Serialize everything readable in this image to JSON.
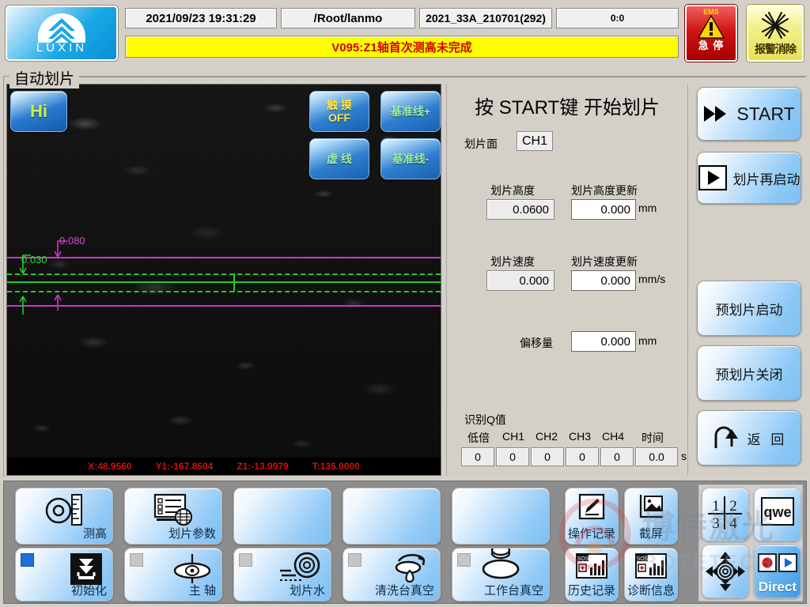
{
  "header": {
    "logo_text": "LUXIN",
    "logo_icon": "luxin-chevron-logo",
    "datetime": "2021/09/23 19:31:29",
    "path": "/Root/lanmo",
    "recipe": "2021_33A_210701(292)",
    "counter": "0:0",
    "alarm_message": "V095:Z1轴首次测高未完成",
    "emergency_stop": {
      "top": "EMS",
      "label": "急 停",
      "icon": "warning-triangle-icon"
    },
    "alarm_clear": {
      "label": "报警消除",
      "icon": "burst-star-icon"
    },
    "colors": {
      "alarm_bg": "#ffff00",
      "alarm_text": "#d00000",
      "ems_red": "#cf1414",
      "alarm_clear_yellow": "#e8e257",
      "logo_blue": "#19a8e8"
    }
  },
  "page": {
    "title": "自动划片"
  },
  "video": {
    "hi_button": "Hi",
    "overlay_buttons": [
      {
        "name": "touch-toggle",
        "line1": "触 摸",
        "line2": "OFF",
        "color": "yellow"
      },
      {
        "name": "baseline-plus",
        "line1": "基准线+",
        "line2": "",
        "color": "green"
      },
      {
        "name": "dashed-line",
        "line1": "虚 线",
        "line2": "",
        "color": "green"
      },
      {
        "name": "baseline-minus",
        "line1": "基准线-",
        "line2": "",
        "color": "green"
      }
    ],
    "annotations": [
      {
        "value": "0.080",
        "color": "#dd44dd"
      },
      {
        "value": "0.030",
        "color": "#33dd33"
      }
    ],
    "coordinates": [
      {
        "label": "X:",
        "value": "48.9560",
        "full": "X:48.9560"
      },
      {
        "label": "Y1:",
        "value": "-167.8504",
        "full": "Y1:-167.8504"
      },
      {
        "label": "Z1:",
        "value": "-13.9979",
        "full": "Z1:-13.9979"
      },
      {
        "label": "T:",
        "value": "135.0000",
        "full": "T:135.0000"
      }
    ],
    "colors": {
      "magenta_line": "#cc33cc",
      "green_line": "#22cc22",
      "coord_text": "#cc1111"
    }
  },
  "center": {
    "instruction": "按 START键 开始划片",
    "cut_face_label": "划片面",
    "cut_face_value": "CH1",
    "cut_height_label": "划片高度",
    "cut_height_value": "0.0600",
    "cut_height_update_label": "划片高度更新",
    "cut_height_update_value": "0.000",
    "cut_height_unit": "mm",
    "cut_speed_label": "划片速度",
    "cut_speed_value": "0.000",
    "cut_speed_update_label": "划片速度更新",
    "cut_speed_update_value": "0.000",
    "cut_speed_unit": "mm/s",
    "offset_label": "偏移量",
    "offset_value": "0.000",
    "offset_unit": "mm",
    "q_title": "识别Q值",
    "q_headers": [
      "低倍",
      "CH1",
      "CH2",
      "CH3",
      "CH4",
      "时间"
    ],
    "q_values": [
      "0",
      "0",
      "0",
      "0",
      "0",
      "0.0"
    ],
    "q_unit": "s"
  },
  "sidebar": {
    "buttons": [
      {
        "label": "START",
        "icon": "double-arrow-play-icon"
      },
      {
        "label": "划片再启动",
        "icon": "play-button-icon"
      },
      {
        "label": "预划片启动",
        "icon": ""
      },
      {
        "label": "预划片关闭",
        "icon": ""
      },
      {
        "label": "返 回",
        "icon": "u-turn-arrow-icon"
      }
    ]
  },
  "toolbar": {
    "row1": [
      {
        "label": "测高",
        "icon": "height-gauge-icon",
        "led": null
      },
      {
        "label": "划片参数",
        "icon": "parameter-list-icon",
        "led": null
      },
      {
        "label": "",
        "icon": "",
        "led": null
      },
      {
        "label": "",
        "icon": "",
        "led": null
      },
      {
        "label": "",
        "icon": "",
        "led": null
      },
      {
        "label": "操作记录",
        "icon": "pencil-edit-icon",
        "led": null
      },
      {
        "label": "截屏",
        "icon": "screenshot-icon",
        "led": null
      }
    ],
    "row2": [
      {
        "label": "初始化",
        "icon": "download-init-icon",
        "led": "on"
      },
      {
        "label": "主 轴",
        "icon": "spindle-icon",
        "led": "off"
      },
      {
        "label": "划片水",
        "icon": "water-nozzle-icon",
        "led": "off"
      },
      {
        "label": "清洗台真空",
        "icon": "vacuum-clean-icon",
        "led": "off"
      },
      {
        "label": "工作台真空",
        "icon": "worktable-vacuum-icon",
        "led": "off"
      },
      {
        "label": "历史记录",
        "icon": "sos-chart-icon",
        "led": null
      },
      {
        "label": "诊断信息",
        "icon": "sos-chart-icon",
        "led": null
      }
    ],
    "utility": [
      {
        "label": "1 2 3 4",
        "icon": "numpad-icon",
        "name": "numeric-keypad"
      },
      {
        "label": "qwe",
        "icon": "keyboard-icon",
        "name": "qwerty-keyboard"
      },
      {
        "label": "",
        "icon": "dpad-icon",
        "name": "jog-dpad"
      },
      {
        "label": "Direct",
        "icon": "record-play-icon",
        "name": "direct-mode"
      }
    ]
  },
  "watermark": {
    "cn": "博特激光",
    "en": "BOTETECH"
  }
}
